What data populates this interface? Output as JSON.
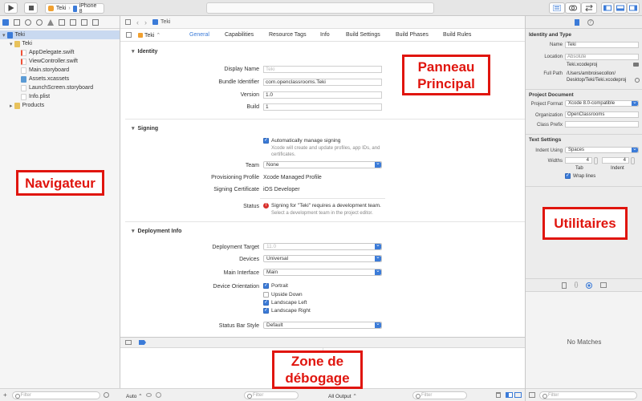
{
  "toolbar": {
    "scheme_target": "Teki",
    "scheme_device": "iPhone 8"
  },
  "navigator": {
    "items": [
      {
        "label": "Teki",
        "level": 0
      },
      {
        "label": "Teki",
        "level": 1
      },
      {
        "label": "AppDelegate.swift",
        "level": 2
      },
      {
        "label": "ViewController.swift",
        "level": 2
      },
      {
        "label": "Main.storyboard",
        "level": 2
      },
      {
        "label": "Assets.xcassets",
        "level": 2
      },
      {
        "label": "LaunchScreen.storyboard",
        "level": 2
      },
      {
        "label": "Info.plist",
        "level": 2
      },
      {
        "label": "Products",
        "level": 1
      }
    ],
    "filter_placeholder": "Filter"
  },
  "editor": {
    "jump_file": "Teki",
    "target": "Teki",
    "tabs": [
      "General",
      "Capabilities",
      "Resource Tags",
      "Info",
      "Build Settings",
      "Build Phases",
      "Build Rules"
    ],
    "identity": {
      "heading": "Identity",
      "display_name_label": "Display Name",
      "display_name_placeholder": "Teki",
      "bundle_id_label": "Bundle Identifier",
      "bundle_id": "com.openclassrooms.Teki",
      "version_label": "Version",
      "version": "1.0",
      "build_label": "Build",
      "build": "1"
    },
    "signing": {
      "heading": "Signing",
      "auto_label": "Automatically manage signing",
      "auto_sub_1": "Xcode will create and update profiles, app IDs, and",
      "auto_sub_2": "certificates.",
      "team_label": "Team",
      "team": "None",
      "profile_label": "Provisioning Profile",
      "profile": "Xcode Managed Profile",
      "cert_label": "Signing Certificate",
      "cert": "iOS Developer",
      "status_label": "Status",
      "status_msg": "Signing for \"Teki\" requires a development team.",
      "status_sub": "Select a development team in the project editor."
    },
    "deployment": {
      "heading": "Deployment Info",
      "target_label": "Deployment Target",
      "target_placeholder": "11.0",
      "devices_label": "Devices",
      "devices": "Universal",
      "interface_label": "Main Interface",
      "interface": "Main",
      "orientation_label": "Device Orientation",
      "orientations": [
        {
          "label": "Portrait",
          "checked": true
        },
        {
          "label": "Upside Down",
          "checked": false
        },
        {
          "label": "Landscape Left",
          "checked": true
        },
        {
          "label": "Landscape Right",
          "checked": true
        }
      ],
      "statusbar_label": "Status Bar Style",
      "statusbar": "Default"
    }
  },
  "debug": {
    "auto": "Auto",
    "filter_placeholder": "Filter",
    "output": "All Output",
    "filter2_placeholder": "Filter"
  },
  "utilities": {
    "identity_heading": "Identity and Type",
    "name_label": "Name",
    "name": "Teki",
    "location_label": "Location",
    "location": "Absolute",
    "location_file": "Teki.xcodeproj",
    "fullpath_label": "Full Path",
    "fullpath_1": "/Users/ambroisecollon/",
    "fullpath_2": "Desktop/Teki/Teki.xcodeproj",
    "projdoc_heading": "Project Document",
    "format_label": "Project Format",
    "format": "Xcode 8.0-compatible",
    "org_label": "Organization",
    "org": "OpenClassrooms",
    "prefix_label": "Class Prefix",
    "text_heading": "Text Settings",
    "indent_label": "Indent Using",
    "indent": "Spaces",
    "widths_label": "Widths",
    "tab_value": "4",
    "indent_value": "4",
    "tab_label": "Tab",
    "indent_col_label": "Indent",
    "wrap_label": "Wrap lines",
    "no_matches": "No Matches",
    "filter_placeholder": "Filter"
  },
  "overlays": {
    "main": "Panneau Principal",
    "navigator": "Navigateur",
    "utilities": "Utilitaires",
    "debug": "Zone de débogage"
  },
  "colors": {
    "accent": "#3b7bd8",
    "overlay_red": "#e0150e",
    "error": "#d8302c"
  }
}
